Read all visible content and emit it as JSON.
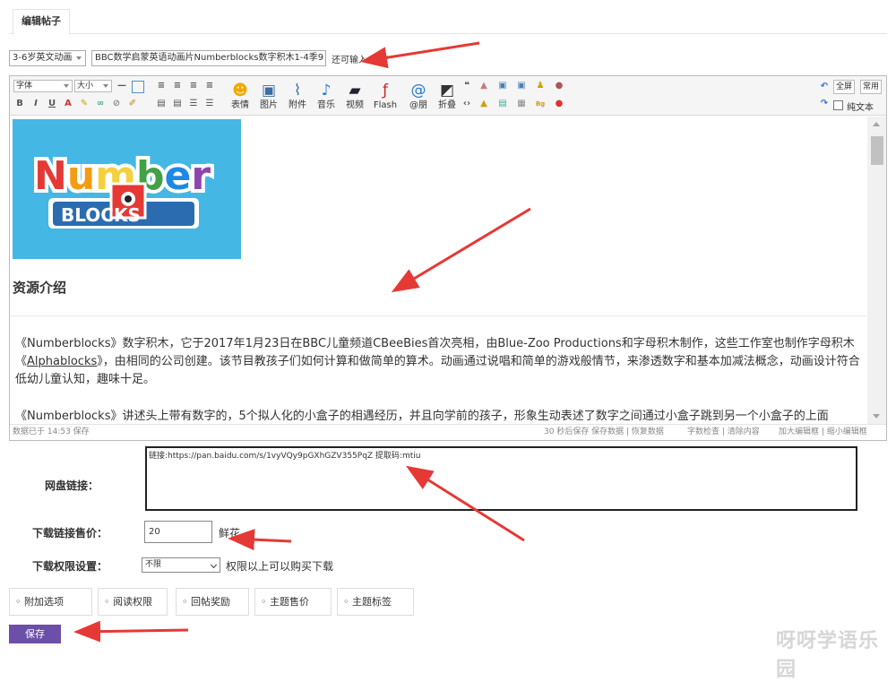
{
  "tab": {
    "label": "编辑帖子"
  },
  "form": {
    "category": "3-6岁英文动画",
    "subject": "BBC数学启蒙英语动画片Numberblocks数字积木1-4季9",
    "hint": "还可输入   字符"
  },
  "toolbar": {
    "font_label": "字体",
    "size_label": "大小",
    "small_icons": [
      "B",
      "I",
      "U",
      "A"
    ],
    "buttons": [
      {
        "label": "表情",
        "icon": "smiley-icon"
      },
      {
        "label": "图片",
        "icon": "image-icon"
      },
      {
        "label": "附件",
        "icon": "paperclip-icon"
      },
      {
        "label": "音乐",
        "icon": "music-icon"
      },
      {
        "label": "视频",
        "icon": "video-icon"
      },
      {
        "label": "Flash",
        "icon": "flash-icon"
      },
      {
        "label": "@朋",
        "icon": "at-icon"
      },
      {
        "label": "折叠",
        "icon": "collapse-icon"
      }
    ],
    "fullscreen_label": "全屏",
    "common_label": "常用",
    "plaintext_label": "纯文本"
  },
  "content": {
    "logo_image": "Numberblocks logo",
    "logo_text": [
      "Number",
      "BLOCKS"
    ],
    "section_title": "资源介绍",
    "para1_a": "《Numberblocks》数字积木，它于2017年1月23日在BBC儿童频道CBeeBies首次亮相，由Blue-Zoo Productions和字母积木制作，这些工作室也制作字母积木《",
    "para1_link": "Alphablocks",
    "para1_b": "》，由相同的公司创建。该节目教孩子们如何计算和做简单的算术。动画通过说唱和简单的游戏般情节，来渗透数字和基本加减法概念，动画设计符合低幼儿童认知，趣味十足。",
    "para2": "《Numberblocks》讲述头上带有数字的，5个拟人化的小盒子的相遇经历，并且向学前的孩子，形象生动表述了数字之间通过小盒子跳到另一个小盒子的上面"
  },
  "statusbar": {
    "saved": "数据已于 14:53 保存",
    "autosave": "30 秒后保存 保存数据 | 恢复数据",
    "tools": "字数检查 | 清除内容",
    "resize": "加大编辑框 | 缩小编辑框"
  },
  "netdisk": {
    "label": "网盘链接：",
    "value": "链接:https://pan.baidu.com/s/1vyVQy9pGXhGZV355PqZ 提取码:mtiu"
  },
  "price": {
    "label": "下载链接售价：",
    "value": "20",
    "unit": "鲜花"
  },
  "permission": {
    "label": "下载权限设置：",
    "value": "不限",
    "suffix": "权限以上可以购买下载"
  },
  "options": [
    "附加选项",
    "阅读权限",
    "回帖奖励",
    "主题售价",
    "主题标签"
  ],
  "save_label": "保存",
  "watermark": "呀呀学语乐园",
  "colors": {
    "save_button": "#6c4fa8",
    "annotation_arrow": "#e53935",
    "logo_bg": "#45b7e4"
  }
}
